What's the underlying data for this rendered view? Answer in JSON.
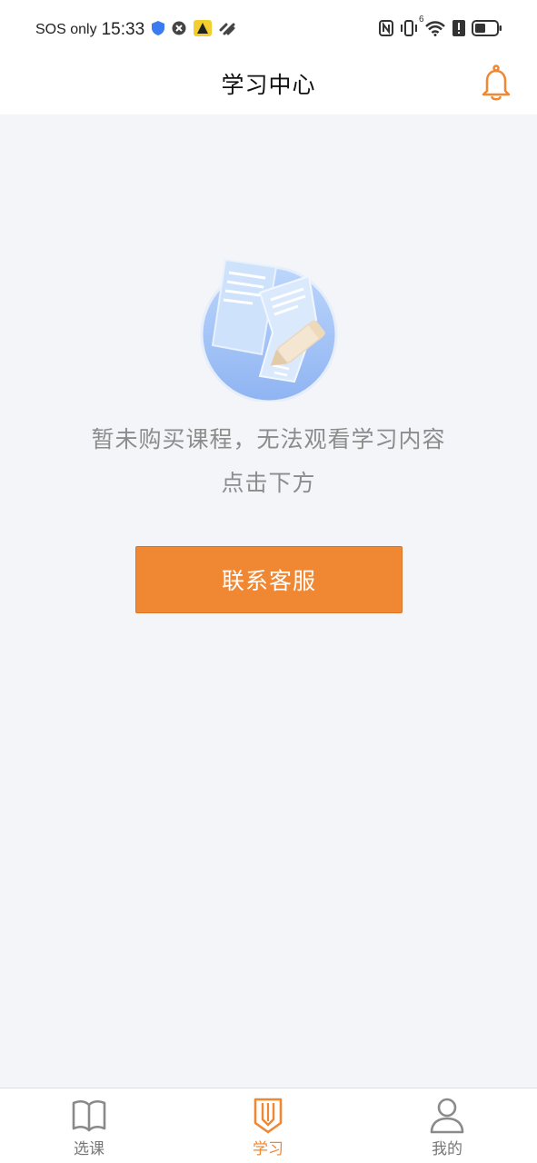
{
  "status_bar": {
    "carrier": "SOS only",
    "time": "15:33",
    "network_label": "6",
    "icons_left": [
      "shield-icon",
      "close-circle-icon",
      "app-badge-icon",
      "wave-icon"
    ],
    "icons_right": [
      "nfc-icon",
      "vibrate-icon",
      "wifi-icon",
      "alert-icon",
      "battery-icon"
    ]
  },
  "header": {
    "title": "学习中心",
    "bell_icon": "bell-icon"
  },
  "empty_state": {
    "illustration_icon": "documents-pencil-icon",
    "message": "暂未购买课程，无法观看学习内容",
    "sub_message": "点击下方",
    "button_label": "联系客服"
  },
  "bottom_nav": {
    "items": [
      {
        "label": "选课",
        "icon": "book-icon",
        "active": false
      },
      {
        "label": "学习",
        "icon": "pencil-book-icon",
        "active": true
      },
      {
        "label": "我的",
        "icon": "user-icon",
        "active": false
      }
    ]
  },
  "colors": {
    "accent": "#ef8733",
    "background": "#f4f5f9",
    "text_muted": "#8c8c8c",
    "nav_inactive": "#777777"
  }
}
